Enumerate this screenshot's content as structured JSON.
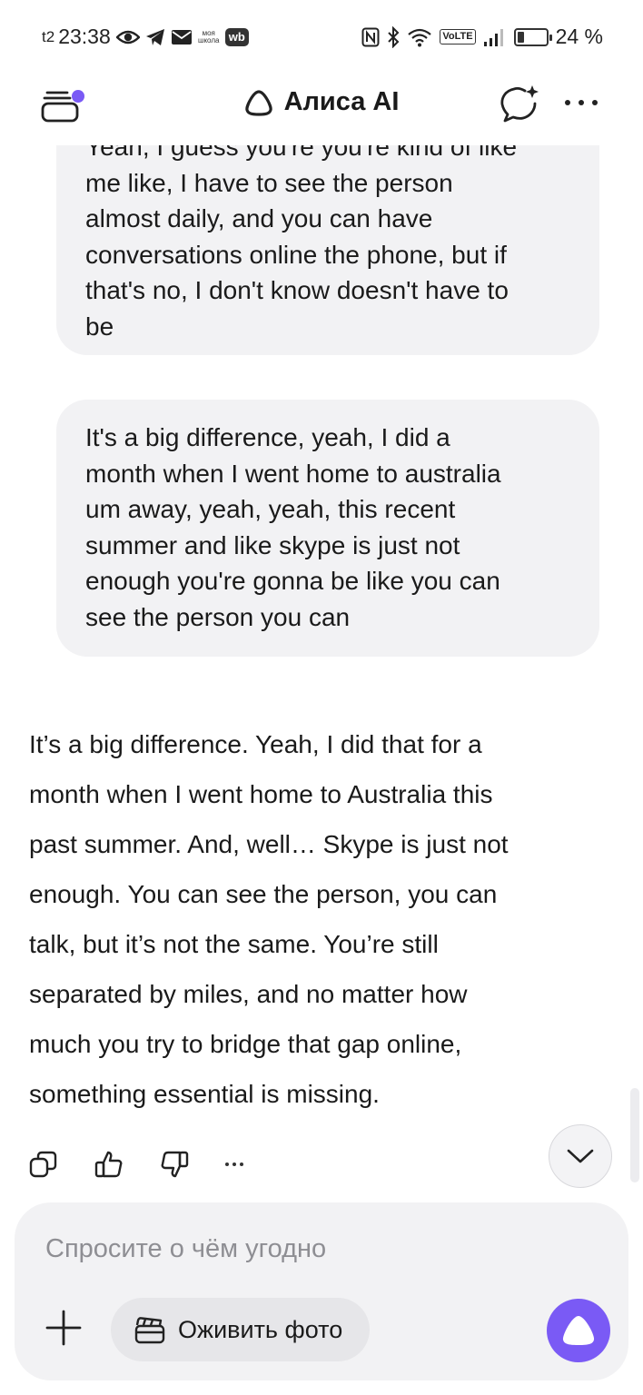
{
  "status_bar": {
    "sim_label": "t2",
    "time": "23:38",
    "school_label": "моя школа",
    "wb_label": "wb",
    "volte_label": "VoLTE",
    "battery_percent": 24,
    "battery_text": "24 %"
  },
  "header": {
    "title": "Алиса AI",
    "icons": {
      "menu": "chats-menu-icon",
      "logo": "alice-logo-icon",
      "new_chat": "new-chat-icon",
      "more": "more-icon"
    },
    "accent_color": "#7a5af5"
  },
  "messages": [
    {
      "role": "user",
      "lines": [
        "Yeah, I guess you're you're kind of like",
        "me like, I have to see the person",
        "almost daily, and you can have",
        "conversations online the phone, but if",
        "that's no, I don't know doesn't have to",
        "be"
      ]
    },
    {
      "role": "user",
      "lines": [
        "It's a big difference, yeah, I did a",
        "month when I went home to australia",
        "um away, yeah, yeah, this recent",
        "summer and like skype is just not",
        "enough you're gonna be like you can",
        "see the person you can"
      ]
    },
    {
      "role": "assistant",
      "lines": [
        "It’s a big difference. Yeah, I did that for a",
        "month when I went home to Australia this",
        "past summer. And, well… Skype is just not",
        "enough. You can see the person, you can",
        "talk, but it’s not the same. You’re still",
        "separated by miles, and no matter how",
        "much you try to bridge that gap online,",
        "something essential is missing."
      ]
    }
  ],
  "message_actions": {
    "icons": [
      "copy-icon",
      "thumbs-up-icon",
      "thumbs-down-icon",
      "more-icon"
    ]
  },
  "composer": {
    "placeholder": "Спросите о чём угодно",
    "value": "",
    "animate_photo_label": "Оживить фото",
    "background": "#f2f2f4",
    "send_button_color": "#7a5af5"
  }
}
